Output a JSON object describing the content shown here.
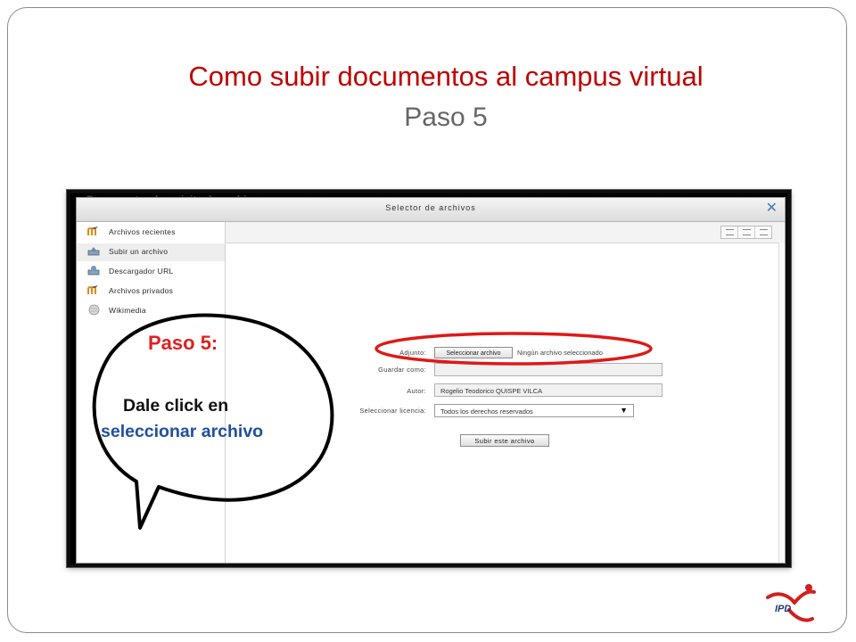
{
  "slide": {
    "title": "Como subir documentos al campus virtual",
    "subtitle": "Paso 5"
  },
  "background_page": {
    "heading": "Documentos (requisitos) a subir:"
  },
  "dialog": {
    "title": "Selector de archivos",
    "close_icon": "close-icon"
  },
  "sidebar": {
    "items": [
      {
        "label": "Archivos recientes",
        "icon": "moodle-icon"
      },
      {
        "label": "Subir un archivo",
        "icon": "upload-icon",
        "active": true
      },
      {
        "label": "Descargador URL",
        "icon": "url-download-icon"
      },
      {
        "label": "Archivos privados",
        "icon": "moodle-icon"
      },
      {
        "label": "Wikimedia",
        "icon": "wikimedia-icon"
      }
    ]
  },
  "form": {
    "attachment_label": "Adjunto:",
    "choose_file_button": "Seleccionar archivo",
    "file_status": "Ningún archivo seleccionado",
    "save_as_label": "Guardar como:",
    "save_as_value": "",
    "author_label": "Autor:",
    "author_value": "Rogelio Teodorico QUISPE VILCA",
    "license_label": "Seleccionar licencia:",
    "license_value": "Todos los derechos reservados",
    "submit_button": "Subir este archivo"
  },
  "callout": {
    "title": "Paso 5:",
    "line1": "Dale click en",
    "line2": "seleccionar archivo"
  },
  "logo": {
    "text": "IPD"
  },
  "colors": {
    "title": "#c00000",
    "subtitle": "#666666",
    "highlight_ellipse": "#e01818",
    "callout_title": "#e02020",
    "callout_link": "#1f4fa0"
  }
}
